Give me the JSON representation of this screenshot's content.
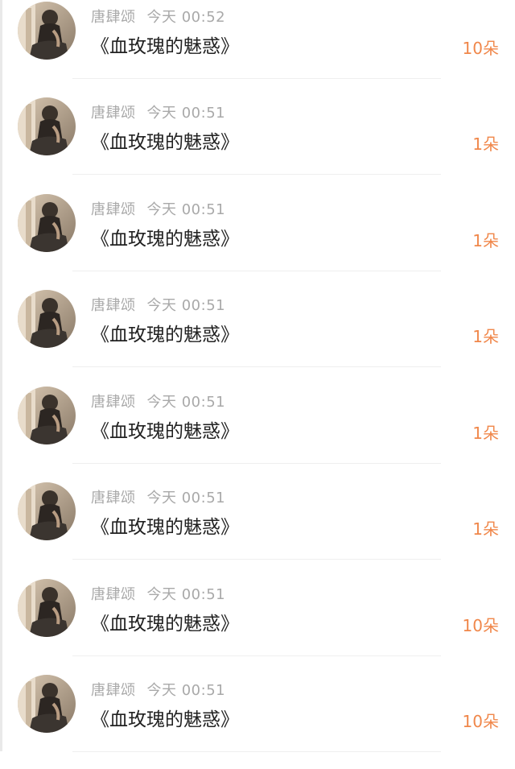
{
  "gift_records": [
    {
      "user": "唐肆颂",
      "time": "今天 00:52",
      "gift": "《血玫瑰的魅惑》",
      "amount": "10朵"
    },
    {
      "user": "唐肆颂",
      "time": "今天 00:51",
      "gift": "《血玫瑰的魅惑》",
      "amount": "1朵"
    },
    {
      "user": "唐肆颂",
      "time": "今天 00:51",
      "gift": "《血玫瑰的魅惑》",
      "amount": "1朵"
    },
    {
      "user": "唐肆颂",
      "time": "今天 00:51",
      "gift": "《血玫瑰的魅惑》",
      "amount": "1朵"
    },
    {
      "user": "唐肆颂",
      "time": "今天 00:51",
      "gift": "《血玫瑰的魅惑》",
      "amount": "1朵"
    },
    {
      "user": "唐肆颂",
      "time": "今天 00:51",
      "gift": "《血玫瑰的魅惑》",
      "amount": "1朵"
    },
    {
      "user": "唐肆颂",
      "time": "今天 00:51",
      "gift": "《血玫瑰的魅惑》",
      "amount": "10朵"
    },
    {
      "user": "唐肆颂",
      "time": "今天 00:51",
      "gift": "《血玫瑰的魅惑》",
      "amount": "10朵"
    }
  ],
  "colors": {
    "amount": "#f0874a",
    "meta": "#a9a9a9",
    "title": "#222222"
  },
  "icons": {
    "avatar": "user-photo-avatar"
  }
}
